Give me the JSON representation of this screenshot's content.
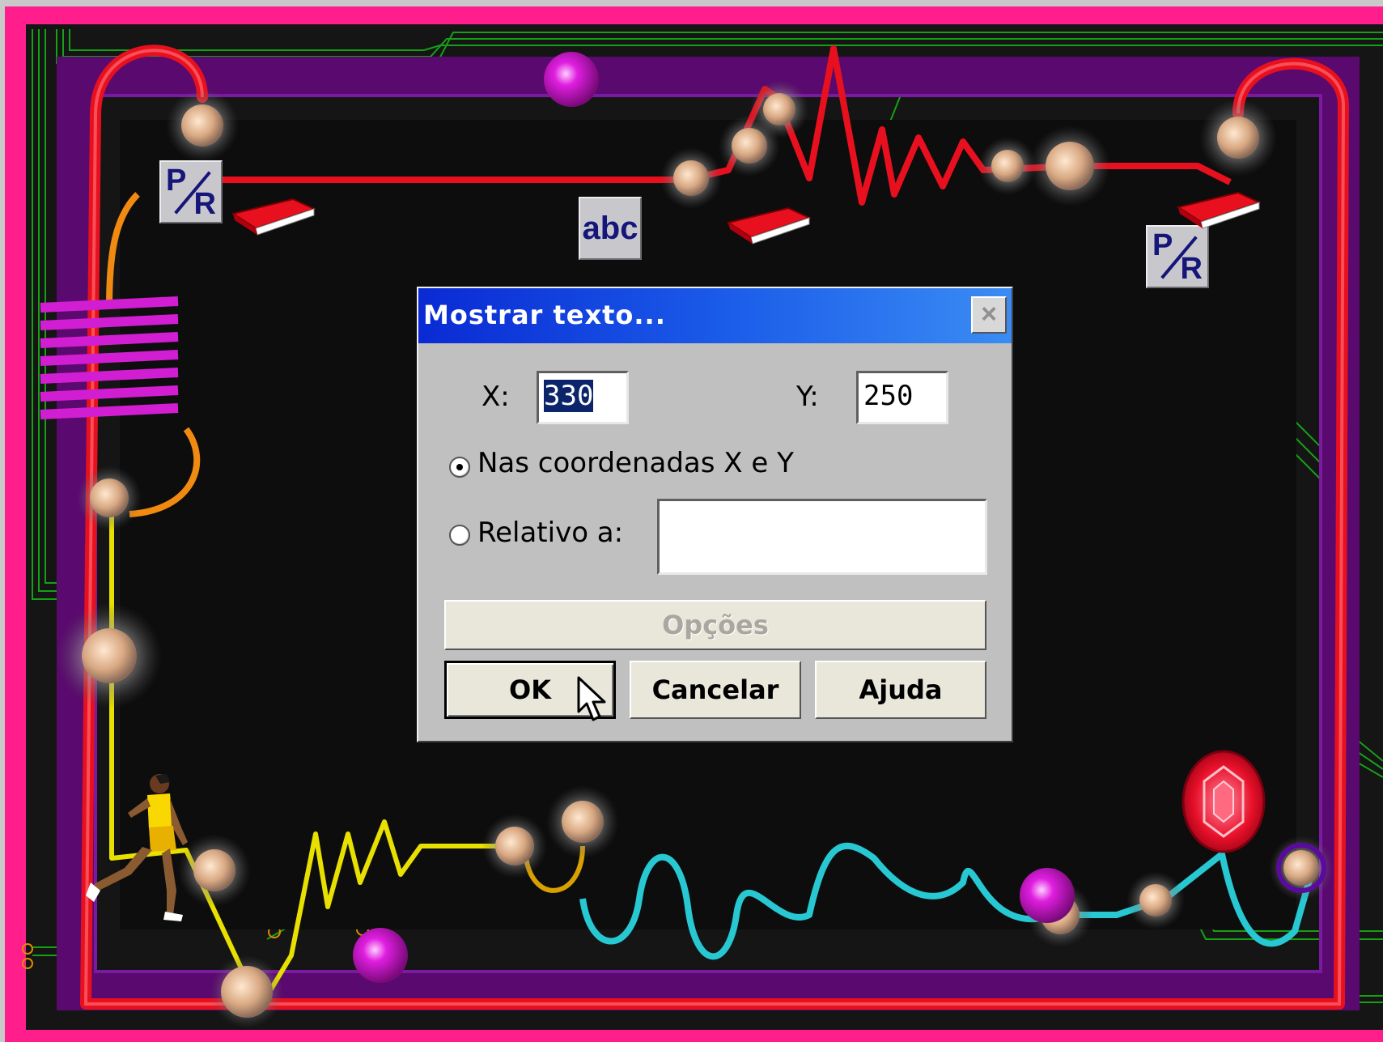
{
  "dialog": {
    "title": "Mostrar texto...",
    "close_label": "×",
    "x_label": "X:",
    "x_value": "330",
    "y_label": "Y:",
    "y_value": "250",
    "radio_coords_label": "Nas coordenadas X e Y",
    "radio_coords_selected": true,
    "radio_relative_label": "Relativo a:",
    "relative_value": "",
    "options_label": "Opções",
    "ok_label": "OK",
    "cancel_label": "Cancelar",
    "help_label": "Ajuda"
  },
  "board": {
    "abc_label": "abc",
    "pr_p": "P",
    "pr_r": "R"
  },
  "colors": {
    "outer_frame": "#ff1e8c",
    "wire_red": "#e8101e",
    "band_purple": "#5a0a6e",
    "wire_cyan": "#28c8d2",
    "wire_yellow": "#f0e000",
    "coil_magenta": "#d21ed2",
    "title_gradient_start": "#0a2ad4",
    "title_gradient_end": "#3a8cf4"
  },
  "icons": [
    "pr-icon",
    "abc-icon",
    "book-icon",
    "runner-icon",
    "ruby-icon",
    "coil-icon",
    "bead-icon"
  ]
}
